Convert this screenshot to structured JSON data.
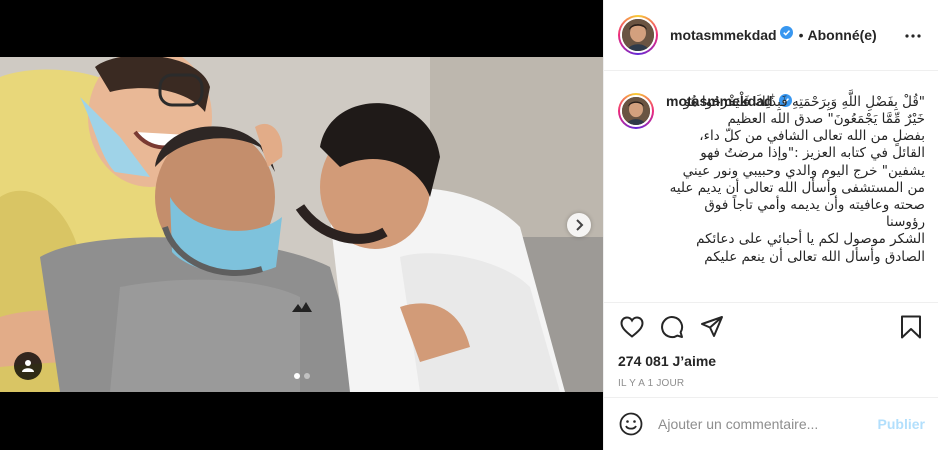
{
  "post": {
    "username": "motasmmekdad",
    "separator": "•",
    "follow_status": "Abonné(e)",
    "caption": "\"قُلْ بِفَضْلِ اللَّهِ وَبِرَحْمَتِهِ فَبِذَٰلِكَ فَلْيَفْرَحُوا هُوَ خَيْرٌ مِّمَّا يَجْمَعُونَ\" صدق الله العظيم\nبفضلٍ من الله تعالى الشافي من كلّ داء، القائل في كتابه العزيز :\"وإذا مرضتُ فهو يشفين\" خرج اليوم والدي وحبيبي ونور عيني من المستشفى وأسأل الله تعالى أن يديم عليه صحته وعافيته وأن يديمه وأمي تاجاً فوق رؤوسنا\nالشكر موصول لكم يا أحبائي على دعائكم الصادق وأسأل الله تعالى أن ينعم عليكم",
    "likes": "274 081 J’aime",
    "time_ago": "IL Y A 1 JOUR",
    "comment_placeholder": "Ajouter un commentaire...",
    "publish_label": "Publier"
  },
  "carousel": {
    "total": 2,
    "current": 1
  },
  "icons": {
    "verified": "verified-badge-icon",
    "more": "more-options-icon",
    "like": "heart-icon",
    "comment": "comment-icon",
    "share": "paper-plane-icon",
    "save": "bookmark-icon",
    "emoji": "emoji-icon",
    "next": "chevron-right-icon",
    "tags": "user-tag-icon"
  },
  "colors": {
    "verified": "#3897f0",
    "publish_disabled": "#b2dffc",
    "muted_text": "#8e8e8e",
    "divider": "#efefef"
  }
}
